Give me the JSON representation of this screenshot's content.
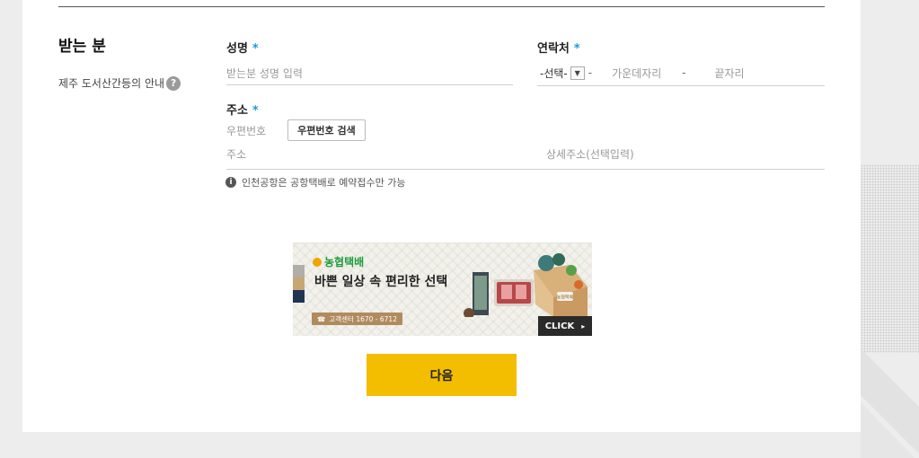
{
  "recipient": {
    "section_title": "받는 분",
    "jeju_notice": "제주 도서산간등의 안내",
    "help_icon_glyph": "?",
    "name_label": "성명",
    "required_mark": "*",
    "name_placeholder": "받는분 성명 입력",
    "phone_label": "연락처",
    "phone_select_value": "-선택-",
    "phone_select_arrow": "▼",
    "phone_dash": "-",
    "phone_middle_placeholder": "가운데자리",
    "phone_last_placeholder": "끝자리",
    "address_label": "주소",
    "zip_label": "우편번호",
    "zip_search_button": "우편번호 검색",
    "address_placeholder": "주소",
    "address_detail_placeholder": "상세주소(선택입력)",
    "info_icon_glyph": "i",
    "airport_notice": "인천공항은 공항택배로 예약접수만 가능"
  },
  "banner": {
    "brand": "농협택배",
    "headline": "바쁜 일상 속 편리한 선택",
    "customer_center": "고객센터 1670 - 6712",
    "click_label": "CLICK",
    "click_arrow": "▸",
    "box_label": "농협택배",
    "icons": [
      "brand-logo-icon",
      "produce-box-icon",
      "meat-tray-icon",
      "phone-icon"
    ]
  },
  "actions": {
    "next_button": "다음"
  },
  "colors": {
    "accent": "#f3bd00",
    "required": "#1a9bd7",
    "brand_green": "#1d9b3a",
    "page_bg": "#ededed"
  }
}
